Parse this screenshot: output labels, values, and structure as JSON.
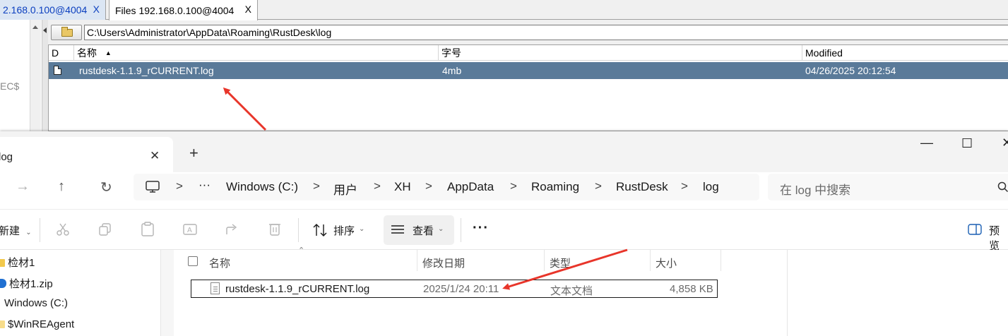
{
  "rustdesk": {
    "tabs": [
      {
        "label": "2.168.0.100@4004",
        "close": "X"
      },
      {
        "label": "Files 192.168.0.100@4004",
        "close": "X"
      }
    ],
    "left_pane_text": "EC$",
    "path": "C:\\Users\\Administrator\\AppData\\Roaming\\RustDesk\\log",
    "columns": {
      "d": "D",
      "name": "名称",
      "size": "字号",
      "modified": "Modified"
    },
    "sort_indicator": "▲",
    "rows": [
      {
        "name": "rustdesk-1.1.9_rCURRENT.log",
        "size": "4mb",
        "modified": "04/26/2025 20:12:54"
      }
    ]
  },
  "explorer": {
    "tab": {
      "title": "log",
      "close": "✕",
      "new_tab": "+"
    },
    "window_buttons": {
      "minimize": "—",
      "maximize": "☐",
      "close": "✕"
    },
    "nav_icons": {
      "forward": "→",
      "up": "↑",
      "refresh": "↻"
    },
    "breadcrumb": {
      "more": "···",
      "separator": ">",
      "items": [
        "Windows (C:)",
        "用户",
        "XH",
        "AppData",
        "Roaming",
        "RustDesk",
        "log"
      ]
    },
    "search": {
      "placeholder": "在 log 中搜索"
    },
    "toolbar": {
      "new_label": "新建",
      "sort_label": "排序",
      "view_label": "查看",
      "more_label": "···",
      "preview_label": "预览"
    },
    "tree": [
      "检材1",
      "检材1.zip",
      "Windows (C:)",
      "$WinREAgent"
    ],
    "columns": {
      "name": "名称",
      "date": "修改日期",
      "type": "类型",
      "size": "大小"
    },
    "rows": [
      {
        "name": "rustdesk-1.1.9_rCURRENT.log",
        "date": "2025/1/24 20:11",
        "type": "文本文档",
        "size": "4,858 KB"
      }
    ]
  },
  "colors": {
    "selection": "#5a7a99",
    "annotation_arrow": "#e8352a"
  }
}
